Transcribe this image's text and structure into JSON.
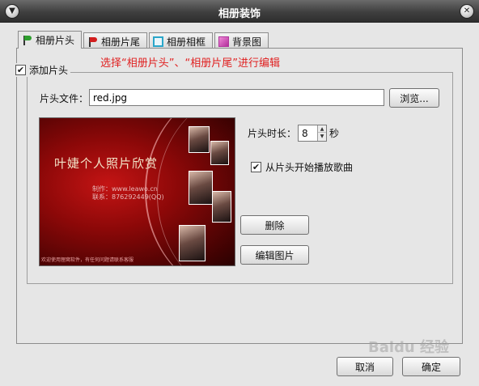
{
  "window": {
    "title": "相册装饰"
  },
  "tabs": [
    {
      "label": "相册片头",
      "icon": "green-flag-icon"
    },
    {
      "label": "相册片尾",
      "icon": "red-flag-icon"
    },
    {
      "label": "相册相框",
      "icon": "frame-icon"
    },
    {
      "label": "背景图",
      "icon": "image-icon"
    }
  ],
  "header_group": {
    "enabled_label": "添加片头",
    "enabled_checked": true,
    "hint": "选择“相册片头”、“相册片尾”进行编辑",
    "file_label": "片头文件：",
    "file_value": "red.jpg",
    "browse_label": "浏览...",
    "preview": {
      "title": "叶婕个人照片欣赏",
      "line1": "制作：www.leawo.cn",
      "line2": "联系：876292449(QQ)",
      "footer": "欢迎使用狸窝软件，有任何问题请联系客服"
    },
    "duration_label": "片头时长：",
    "duration_value": "8",
    "duration_unit": "秒",
    "play_from_header_label": "从片头开始播放歌曲",
    "play_from_header_checked": true,
    "delete_label": "删除",
    "edit_label": "编辑图片"
  },
  "footer": {
    "cancel_label": "取消",
    "ok_label": "确定"
  },
  "watermark": "Baidu 经验"
}
